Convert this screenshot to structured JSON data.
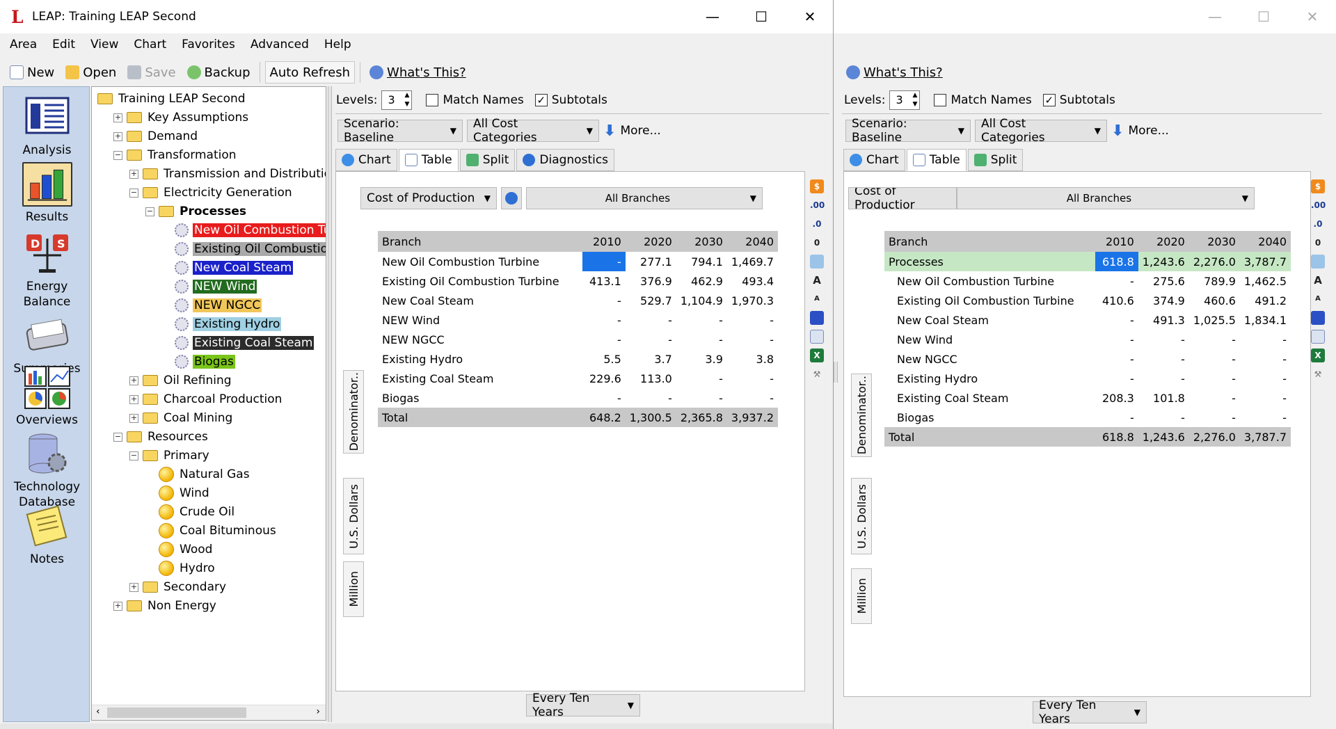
{
  "window_a": {
    "title": "LEAP: Training LEAP Second",
    "menu": [
      "Area",
      "Edit",
      "View",
      "Chart",
      "Favorites",
      "Advanced",
      "Help"
    ],
    "toolbar": {
      "new": "New",
      "open": "Open",
      "save": "Save",
      "backup": "Backup",
      "auto_refresh": "Auto Refresh",
      "whats_this": "What's This?"
    }
  },
  "sidebar": [
    {
      "label": "Analysis",
      "icon": "analysis-icon"
    },
    {
      "label": "Results",
      "icon": "results-icon"
    },
    {
      "label": "Energy Balance",
      "icon": "energy-balance-icon"
    },
    {
      "label": "Summaries",
      "icon": "summaries-icon"
    },
    {
      "label": "Overviews",
      "icon": "overviews-icon"
    },
    {
      "label": "Technology Database",
      "icon": "technology-database-icon"
    },
    {
      "label": "Notes",
      "icon": "notes-icon"
    }
  ],
  "tree": [
    {
      "label": "Training LEAP Second",
      "level": 0,
      "type": "folder"
    },
    {
      "label": "Key Assumptions",
      "level": 1,
      "type": "folder",
      "exp": "+"
    },
    {
      "label": "Demand",
      "level": 1,
      "type": "folder",
      "exp": "+"
    },
    {
      "label": "Transformation",
      "level": 1,
      "type": "folder",
      "exp": "-"
    },
    {
      "label": "Transmission and Distribution",
      "level": 2,
      "type": "folder",
      "exp": "+"
    },
    {
      "label": "Electricity Generation",
      "level": 2,
      "type": "folder",
      "exp": "-"
    },
    {
      "label": "Processes",
      "level": 3,
      "type": "folder",
      "exp": "-",
      "bold": true
    },
    {
      "label": "New Oil Combustion Tu",
      "level": 4,
      "type": "gear",
      "bg": "#e81c1c",
      "fg": "#ffffff"
    },
    {
      "label": "Existing Oil Combustion",
      "level": 4,
      "type": "gear",
      "bg": "#a9a9a9",
      "fg": "#000000"
    },
    {
      "label": "New Coal Steam",
      "level": 4,
      "type": "gear",
      "bg": "#1a21c9",
      "fg": "#ffffff"
    },
    {
      "label": "NEW Wind",
      "level": 4,
      "type": "gear",
      "bg": "#216b1f",
      "fg": "#ffffff"
    },
    {
      "label": "NEW NGCC",
      "level": 4,
      "type": "gear",
      "bg": "#f1c75a",
      "fg": "#000000"
    },
    {
      "label": "Existing Hydro",
      "level": 4,
      "type": "gear",
      "bg": "#9fcfe3",
      "fg": "#000000"
    },
    {
      "label": "Existing Coal Steam",
      "level": 4,
      "type": "gear",
      "bg": "#2b2b2b",
      "fg": "#ffffff"
    },
    {
      "label": "Biogas",
      "level": 4,
      "type": "gear",
      "bg": "#7ac51a",
      "fg": "#000000"
    },
    {
      "label": "Oil Refining",
      "level": 2,
      "type": "folder",
      "exp": "+"
    },
    {
      "label": "Charcoal Production",
      "level": 2,
      "type": "folder",
      "exp": "+"
    },
    {
      "label": "Coal Mining",
      "level": 2,
      "type": "folder",
      "exp": "+"
    },
    {
      "label": "Resources",
      "level": 1,
      "type": "folder",
      "exp": "-"
    },
    {
      "label": "Primary",
      "level": 2,
      "type": "folder",
      "exp": "-"
    },
    {
      "label": "Natural Gas",
      "level": 3,
      "type": "ball"
    },
    {
      "label": "Wind",
      "level": 3,
      "type": "ball"
    },
    {
      "label": "Crude Oil",
      "level": 3,
      "type": "ball"
    },
    {
      "label": "Coal Bituminous",
      "level": 3,
      "type": "ball"
    },
    {
      "label": "Wood",
      "level": 3,
      "type": "ball"
    },
    {
      "label": "Hydro",
      "level": 3,
      "type": "ball"
    },
    {
      "label": "Secondary",
      "level": 2,
      "type": "folder",
      "exp": "+"
    },
    {
      "label": "Non Energy",
      "level": 1,
      "type": "folder",
      "exp": "+"
    }
  ],
  "panel_a": {
    "levels_label": "Levels:",
    "levels": "3",
    "match_names": "Match Names",
    "match_checked": "",
    "subtotals": "Subtotals",
    "subtotals_checked": "✓",
    "scenario": "Scenario: Baseline",
    "cost_categories": "All Cost Categories",
    "more": "More...",
    "tabs": [
      "Chart",
      "Table",
      "Split",
      "Diagnostics"
    ],
    "variable": "Cost of Production",
    "branches": "All Branches",
    "vtabs": [
      "Denominator..",
      "U.S. Dollars",
      "Million"
    ],
    "headers": [
      "Branch",
      "2010",
      "2020",
      "2030",
      "2040"
    ],
    "rows": [
      [
        "New Oil Combustion Turbine",
        "-",
        "277.1",
        "794.1",
        "1,469.7"
      ],
      [
        "Existing Oil Combustion Turbine",
        "413.1",
        "376.9",
        "462.9",
        "493.4"
      ],
      [
        "New Coal Steam",
        "-",
        "529.7",
        "1,104.9",
        "1,970.3"
      ],
      [
        "NEW Wind",
        "-",
        "-",
        "-",
        "-"
      ],
      [
        "NEW NGCC",
        "-",
        "-",
        "-",
        "-"
      ],
      [
        "Existing Hydro",
        "5.5",
        "3.7",
        "3.9",
        "3.8"
      ],
      [
        "Existing Coal Steam",
        "229.6",
        "113.0",
        "-",
        "-"
      ],
      [
        "Biogas",
        "-",
        "-",
        "-",
        "-"
      ]
    ],
    "total": [
      "Total",
      "648.2",
      "1,300.5",
      "2,365.8",
      "3,937.2"
    ],
    "interval": "Every Ten Years"
  },
  "panel_b": {
    "whats_this": "What's This?",
    "levels_label": "Levels:",
    "levels": "3",
    "match_names": "Match Names",
    "match_checked": "",
    "subtotals": "Subtotals",
    "subtotals_checked": "✓",
    "scenario": "Scenario: Baseline",
    "cost_categories": "All Cost Categories",
    "more": "More...",
    "tabs": [
      "Chart",
      "Table",
      "Split"
    ],
    "variable": "Cost of Productior",
    "branches": "All Branches",
    "vtabs": [
      "Denominator..",
      "U.S. Dollars",
      "Million"
    ],
    "headers": [
      "Branch",
      "2010",
      "2020",
      "2030",
      "2040"
    ],
    "group": [
      "Processes",
      "618.8",
      "1,243.6",
      "2,276.0",
      "3,787.7"
    ],
    "rows": [
      [
        "New Oil Combustion Turbine",
        "-",
        "275.6",
        "789.9",
        "1,462.5"
      ],
      [
        "Existing Oil Combustion Turbine",
        "410.6",
        "374.9",
        "460.6",
        "491.2"
      ],
      [
        "New Coal Steam",
        "-",
        "491.3",
        "1,025.5",
        "1,834.1"
      ],
      [
        "New Wind",
        "-",
        "-",
        "-",
        "-"
      ],
      [
        "New NGCC",
        "-",
        "-",
        "-",
        "-"
      ],
      [
        "Existing Hydro",
        "-",
        "-",
        "-",
        "-"
      ],
      [
        "Existing Coal Steam",
        "208.3",
        "101.8",
        "-",
        "-"
      ],
      [
        "Biogas",
        "-",
        "-",
        "-",
        "-"
      ]
    ],
    "total": [
      "Total",
      "618.8",
      "1,243.6",
      "2,276.0",
      "3,787.7"
    ],
    "interval": "Every Ten Years"
  }
}
